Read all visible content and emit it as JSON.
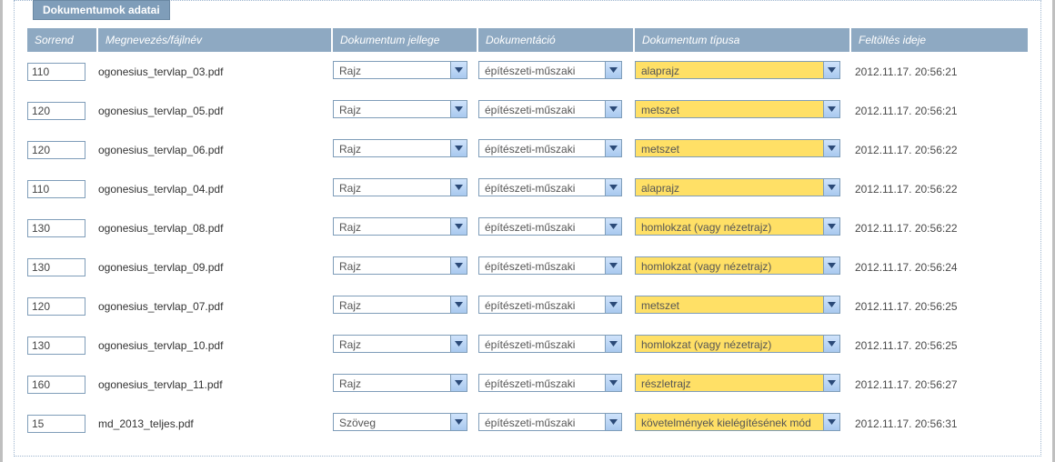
{
  "panel": {
    "title": "Dokumentumok adatai"
  },
  "headers": {
    "order": "Sorrend",
    "file": "Megnevezés/fájlnév",
    "jelleg": "Dokumentum jellege",
    "doku": "Dokumentáció",
    "type": "Dokumentum típusa",
    "upload": "Feltöltés ideje"
  },
  "rows": [
    {
      "order": "110",
      "file": "ogonesius_tervlap_03.pdf",
      "jelleg": "Rajz",
      "doku": "építészeti-műszaki",
      "type": "alaprajz",
      "upload": "2012.11.17. 20:56:21"
    },
    {
      "order": "120",
      "file": "ogonesius_tervlap_05.pdf",
      "jelleg": "Rajz",
      "doku": "építészeti-műszaki",
      "type": "metszet",
      "upload": "2012.11.17. 20:56:21"
    },
    {
      "order": "120",
      "file": "ogonesius_tervlap_06.pdf",
      "jelleg": "Rajz",
      "doku": "építészeti-műszaki",
      "type": "metszet",
      "upload": "2012.11.17. 20:56:22"
    },
    {
      "order": "110",
      "file": "ogonesius_tervlap_04.pdf",
      "jelleg": "Rajz",
      "doku": "építészeti-műszaki",
      "type": "alaprajz",
      "upload": "2012.11.17. 20:56:22"
    },
    {
      "order": "130",
      "file": "ogonesius_tervlap_08.pdf",
      "jelleg": "Rajz",
      "doku": "építészeti-műszaki",
      "type": "homlokzat (vagy nézetrajz)",
      "upload": "2012.11.17. 20:56:22"
    },
    {
      "order": "130",
      "file": "ogonesius_tervlap_09.pdf",
      "jelleg": "Rajz",
      "doku": "építészeti-műszaki",
      "type": "homlokzat (vagy nézetrajz)",
      "upload": "2012.11.17. 20:56:24"
    },
    {
      "order": "120",
      "file": "ogonesius_tervlap_07.pdf",
      "jelleg": "Rajz",
      "doku": "építészeti-műszaki",
      "type": "metszet",
      "upload": "2012.11.17. 20:56:25"
    },
    {
      "order": "130",
      "file": "ogonesius_tervlap_10.pdf",
      "jelleg": "Rajz",
      "doku": "építészeti-műszaki",
      "type": "homlokzat (vagy nézetrajz)",
      "upload": "2012.11.17. 20:56:25"
    },
    {
      "order": "160",
      "file": "ogonesius_tervlap_11.pdf",
      "jelleg": "Rajz",
      "doku": "építészeti-műszaki",
      "type": "részletrajz",
      "upload": "2012.11.17. 20:56:27"
    },
    {
      "order": "15",
      "file": "md_2013_teljes.pdf",
      "jelleg": "Szöveg",
      "doku": "építészeti-műszaki",
      "type": "követelmények kielégítésének mód",
      "upload": "2012.11.17. 20:56:31"
    }
  ]
}
